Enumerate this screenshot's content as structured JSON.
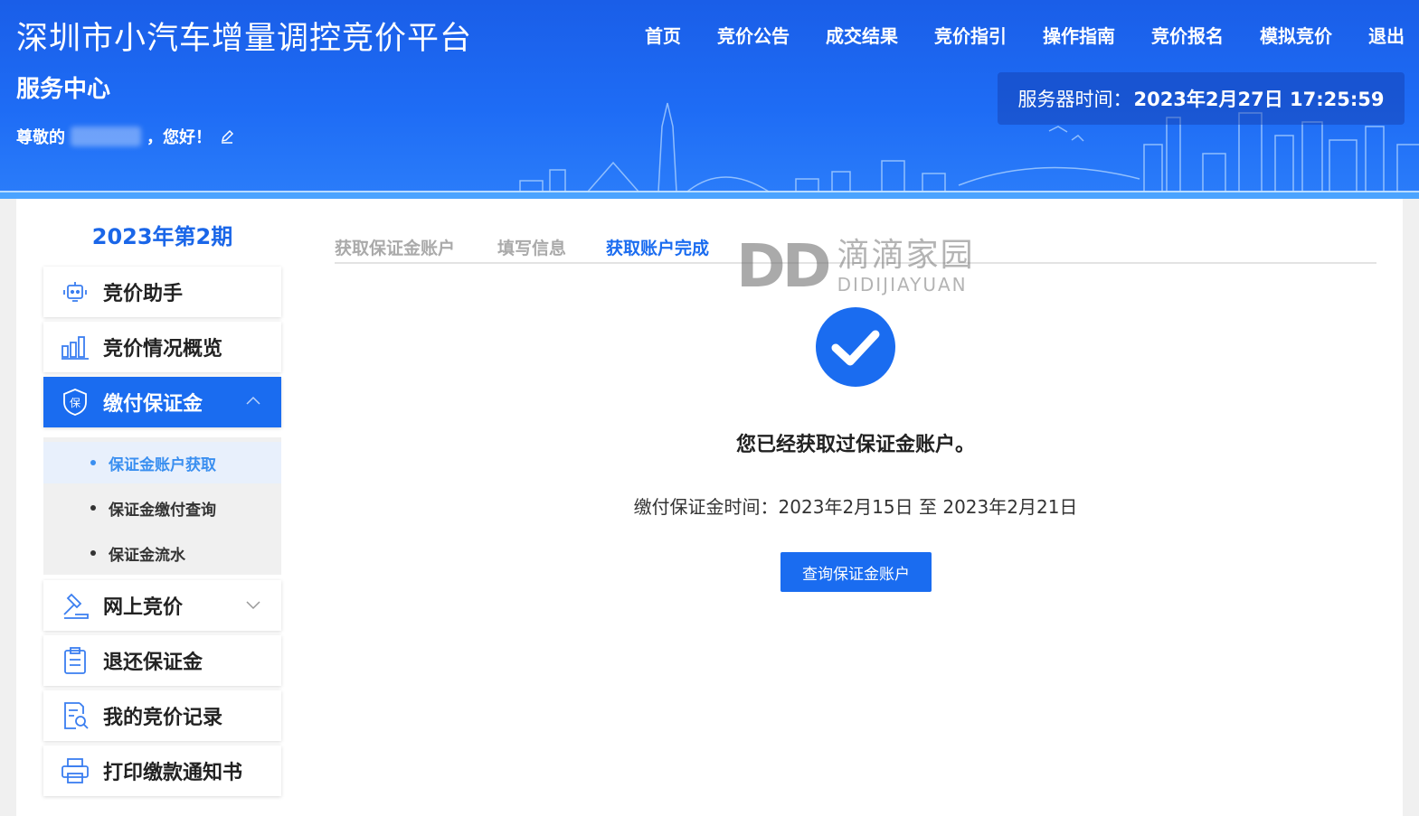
{
  "header": {
    "title": "深圳市小汽车增量调控竞价平台",
    "subtitle": "服务中心",
    "greeting_prefix": "尊敬的",
    "greeting_suffix": "，您好！",
    "server_time_label": "服务器时间：",
    "server_time_value": "2023年2月27日 17:25:59"
  },
  "nav": [
    "首页",
    "竞价公告",
    "成交结果",
    "竞价指引",
    "操作指南",
    "竞价报名",
    "模拟竞价",
    "退出"
  ],
  "sidebar": {
    "period": "2023年第2期",
    "items": [
      {
        "label": "竞价助手",
        "icon": "robot-icon"
      },
      {
        "label": "竞价情况概览",
        "icon": "bar-chart-icon"
      },
      {
        "label": "缴付保证金",
        "icon": "shield-icon"
      },
      {
        "label": "网上竞价",
        "icon": "gavel-icon"
      },
      {
        "label": "退还保证金",
        "icon": "clipboard-icon"
      },
      {
        "label": "我的竞价记录",
        "icon": "document-search-icon"
      },
      {
        "label": "打印缴款通知书",
        "icon": "printer-icon"
      }
    ],
    "submenu": [
      "保证金账户获取",
      "保证金缴付查询",
      "保证金流水"
    ]
  },
  "steps": [
    "获取保证金账户",
    "填写信息",
    "获取账户完成"
  ],
  "watermark": {
    "mark": "DD",
    "cn": "滴滴家园",
    "en": "DIDIJIAYUAN"
  },
  "result": {
    "message": "您已经获取过保证金账户。",
    "period_text": "缴付保证金时间：2023年2月15日 至 2023年2月21日",
    "button": "查询保证金账户"
  },
  "colors": {
    "primary": "#1a6cf0",
    "header": "#1e6cf5",
    "step_inactive": "#aaaaaa"
  }
}
